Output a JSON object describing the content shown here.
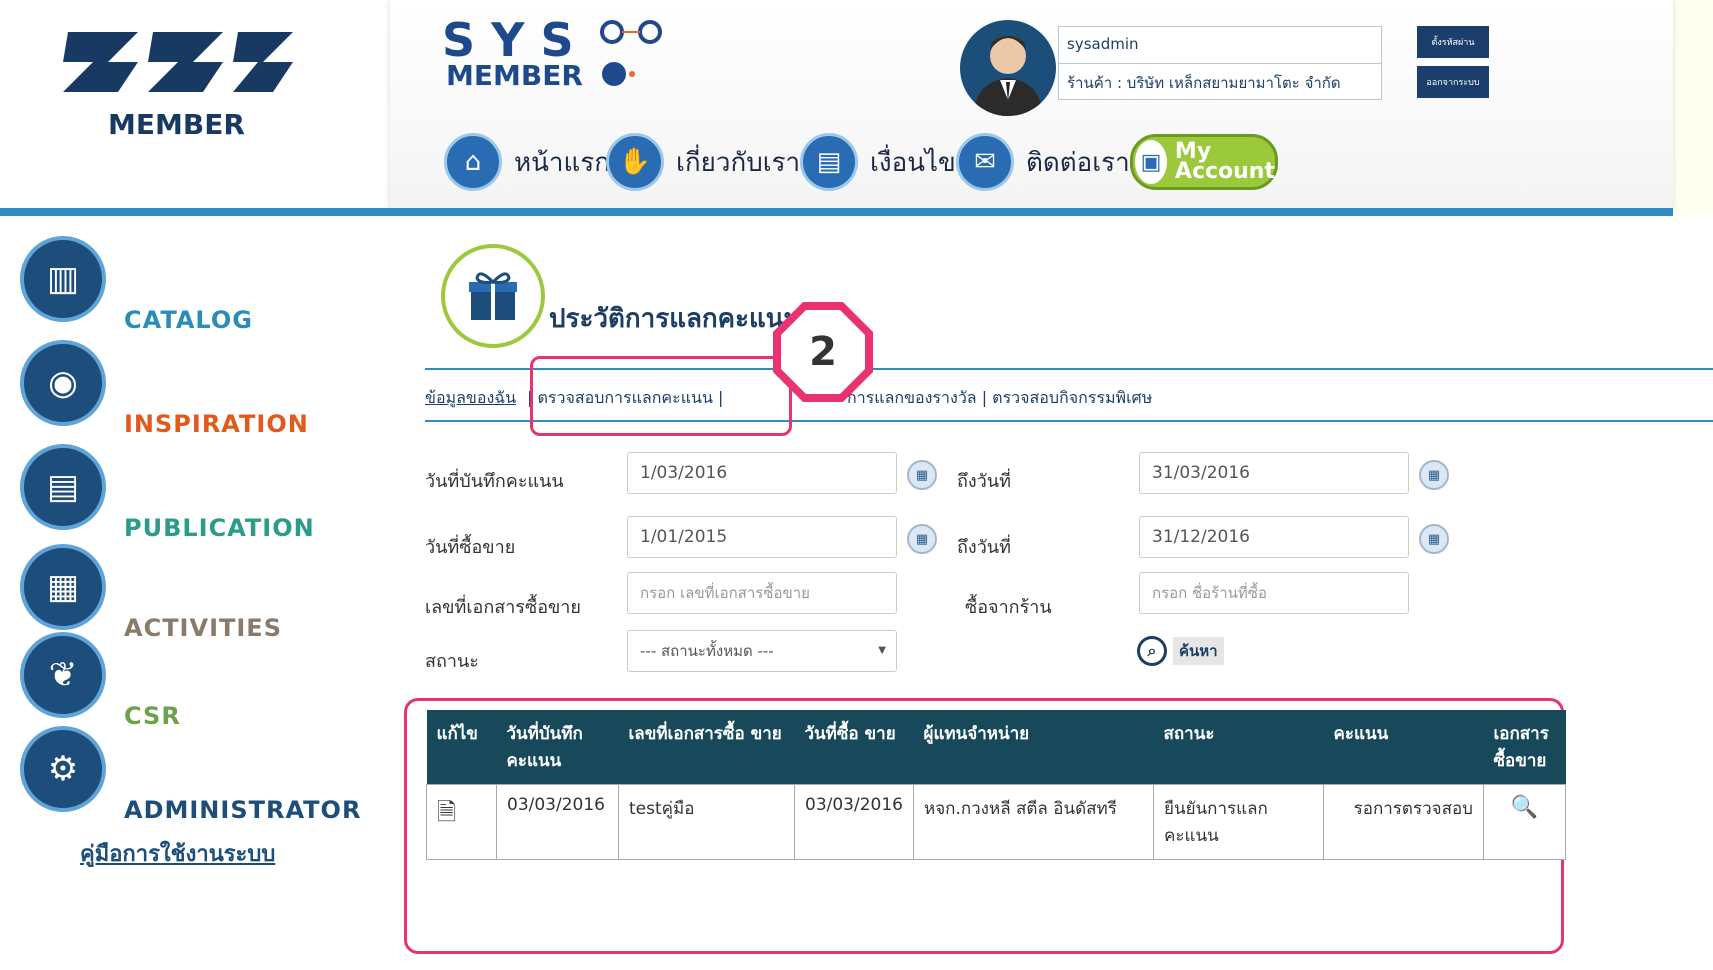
{
  "logo": {
    "brand_text": "SYS",
    "sub_text": "MEMBER"
  },
  "header_logo": {
    "line1": "S Y S",
    "line2": "MEMBER"
  },
  "user": {
    "username": "sysadmin",
    "store_label": "ร้านค้า : บริษัท เหล็กสยามยามาโตะ จำกัด"
  },
  "header_buttons": {
    "settings_label": "ตั้งรหัสผ่าน",
    "logout_label": "ออกจากระบบ"
  },
  "nav": {
    "home": "หน้าแรก",
    "about": "เกี่ยวกับเรา",
    "terms": "เงื่อนไข",
    "contact": "ติดต่อเรา",
    "myaccount_line1": "My",
    "myaccount_line2": "Account"
  },
  "sidebar": {
    "items": [
      {
        "label": "CATALOG",
        "color": "#2a8db8"
      },
      {
        "label": "INSPIRATION",
        "color": "#e05a1c"
      },
      {
        "label": "PUBLICATION",
        "color": "#2a9c8a"
      },
      {
        "label": "ACTIVITIES",
        "color": "#8a7a6a"
      },
      {
        "label": "CSR",
        "color": "#6fa04a"
      },
      {
        "label": "ADMINISTRATOR",
        "color": "#1d4d7a"
      }
    ],
    "manual_link": "คู่มือการใช้งานระบบ"
  },
  "page": {
    "title": "ประวัติการแลกคะแนน"
  },
  "tabs": {
    "my_info": "ข้อมูลของฉัน",
    "check_points": "| ตรวจสอบการแลกคะแนน |",
    "rest": "การแลกของรางวัล | ตรวจสอบกิจกรรมพิเศษ"
  },
  "callout": {
    "number": "2"
  },
  "filters": {
    "record_date_label": "วันที่บันทึกคะแนน",
    "record_date_from": "1/03/2016",
    "to_label": "ถึงวันที่",
    "record_date_to": "31/03/2016",
    "sale_date_label": "วันที่ซื้อขาย",
    "sale_date_from": "1/01/2015",
    "sale_date_to": "31/12/2016",
    "doc_no_label": "เลขที่เอกสารซื้อขาย",
    "doc_no_placeholder": "กรอก เลขที่เอกสารซื้อขาย",
    "bought_from_label": "ซื้อจากร้าน",
    "bought_from_placeholder": "กรอก ชื่อร้านที่ซื้อ",
    "status_label": "สถานะ",
    "status_selected": "--- สถานะทั้งหมด ---",
    "search_label": "ค้นหา"
  },
  "table": {
    "headers": [
      "แก้ไข",
      "วันที่บันทึก คะแนน",
      "เลขที่เอกสารซื้อ ขาย",
      "วันที่ซื้อ ขาย",
      "ผู้แทนจำหน่าย",
      "สถานะ",
      "คะแนน",
      "เอกสาร ซื้อขาย"
    ],
    "rows": [
      {
        "record_date": "03/03/2016",
        "doc_no": "testคู่มือ",
        "sale_date": "03/03/2016",
        "dealer": "หจก.กวงหลี สตีล อินดัสทรี",
        "status": "ยืนยันการแลก คะแนน",
        "points": "รอการตรวจสอบ"
      }
    ]
  },
  "colors": {
    "accent_blue": "#2d8cc3",
    "highlight": "#e8336e",
    "table_header": "#17495a"
  }
}
